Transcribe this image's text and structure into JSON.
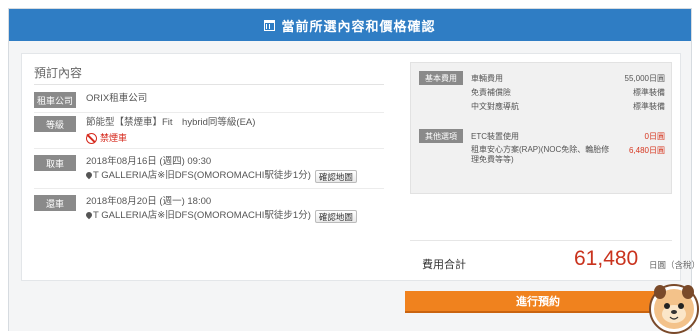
{
  "header": {
    "title": "當前所選內容和價格確認",
    "icon": "calendar-icon"
  },
  "booking": {
    "section_title": "預訂內容",
    "company": {
      "label": "租車公司",
      "value": "ORIX租車公司"
    },
    "class": {
      "label": "等級",
      "value": "節能型【禁煙車】Fit　hybrid同等級(EA)",
      "smoke_label": "禁煙車"
    },
    "pickup": {
      "label": "取車",
      "datetime": "2018年08月16日 (週四) 09:30",
      "location": "T GALLERIA店※旧DFS(OMOROMACHI駅徒步1分)",
      "map_button": "確認地圖"
    },
    "return": {
      "label": "還車",
      "datetime": "2018年08月20日 (週一) 18:00",
      "location": "T GALLERIA店※旧DFS(OMOROMACHI駅徒步1分)",
      "map_button": "確認地圖"
    }
  },
  "fees": {
    "basic": {
      "label": "基本費用",
      "items": [
        {
          "name": "車輛費用",
          "amount": "55,000日圓"
        },
        {
          "name": "免責補償險",
          "amount": "標準裝備"
        },
        {
          "name": "中文對應導航",
          "amount": "標準裝備"
        }
      ]
    },
    "other": {
      "label": "其他選項",
      "items": [
        {
          "name": "ETC裝置使用",
          "amount": "0日圓"
        },
        {
          "name": "租車安心方案(RAP)(NOC免除、輪胎修理免費等等)",
          "amount": "6,480日圓"
        }
      ]
    }
  },
  "total": {
    "label": "費用合計",
    "amount": "61,480",
    "unit": "日圓（含稅）"
  },
  "confirm_button": "進行預約",
  "colors": {
    "header": "#2f7dc4",
    "button": "#f0821e",
    "total": "#c9331e",
    "smoke": "#d62a1e"
  }
}
